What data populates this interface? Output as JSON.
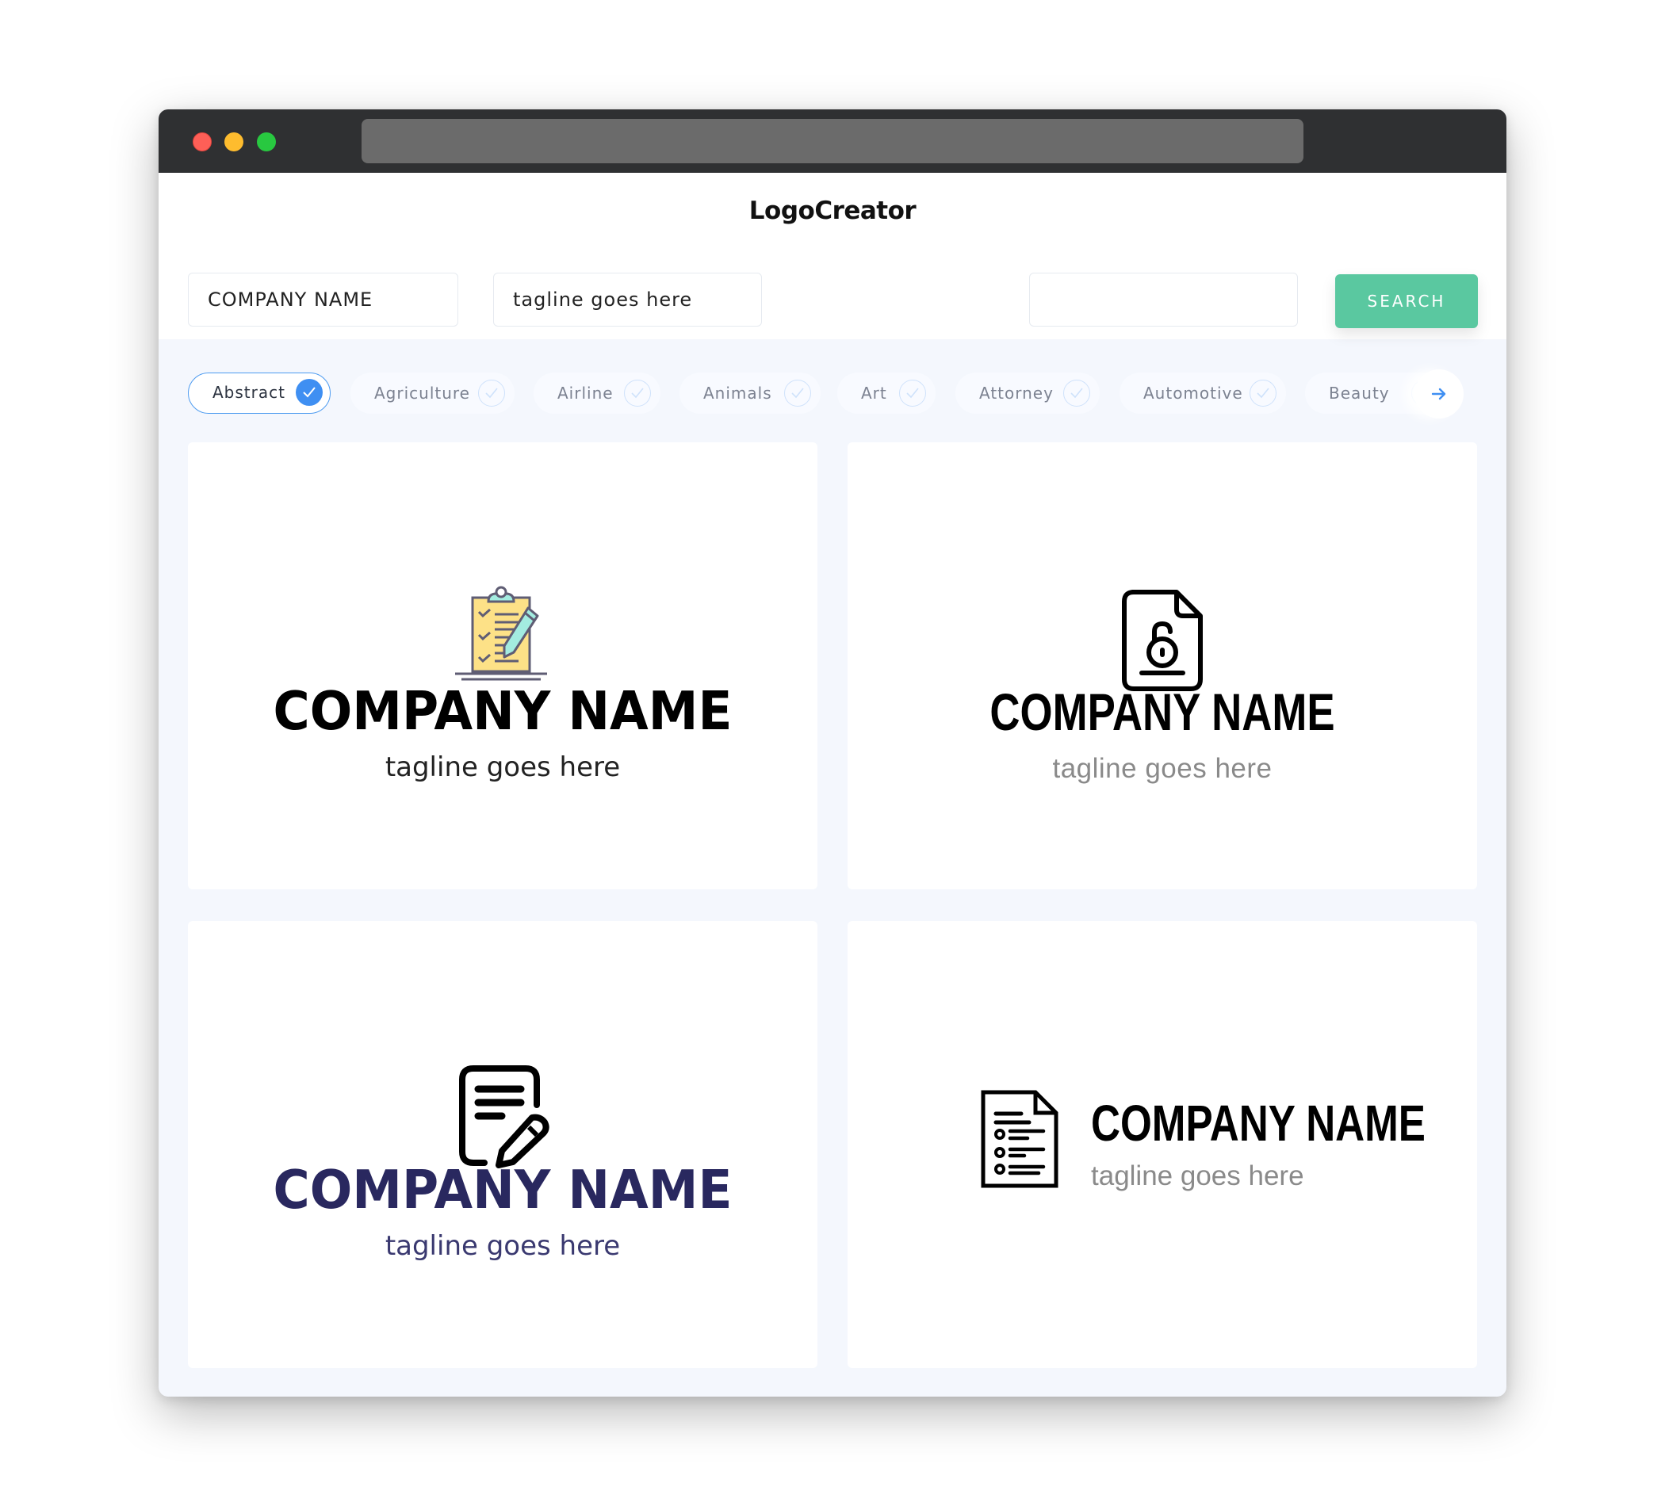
{
  "window": {
    "traffic_lights": [
      "close",
      "minimize",
      "maximize"
    ],
    "url": ""
  },
  "header": {
    "title": "LogoCreator"
  },
  "search": {
    "company_name_value": "COMPANY NAME",
    "tagline_value": "tagline goes here",
    "keyword_value": "",
    "button_label": "SEARCH"
  },
  "categories": [
    {
      "label": "Abstract",
      "selected": true
    },
    {
      "label": "Agriculture",
      "selected": false
    },
    {
      "label": "Airline",
      "selected": false
    },
    {
      "label": "Animals",
      "selected": false
    },
    {
      "label": "Art",
      "selected": false
    },
    {
      "label": "Attorney",
      "selected": false
    },
    {
      "label": "Automotive",
      "selected": false
    },
    {
      "label": "Beauty",
      "selected": false
    }
  ],
  "colors": {
    "accent_green": "#5ac8a0",
    "accent_blue": "#3f8ff2",
    "navy": "#29285f",
    "clipboard_yellow": "#fde187",
    "clipboard_mint": "#a3ece0"
  },
  "logos": [
    {
      "icon": "clipboard-checklist-pencil-icon",
      "company": "COMPANY NAME",
      "tagline": "tagline goes here"
    },
    {
      "icon": "locked-file-icon",
      "company": "COMPANY NAME",
      "tagline": "tagline goes here"
    },
    {
      "icon": "document-edit-icon",
      "company": "COMPANY NAME",
      "tagline": "tagline goes here"
    },
    {
      "icon": "document-list-icon",
      "company": "COMPANY NAME",
      "tagline": "tagline goes here"
    }
  ]
}
